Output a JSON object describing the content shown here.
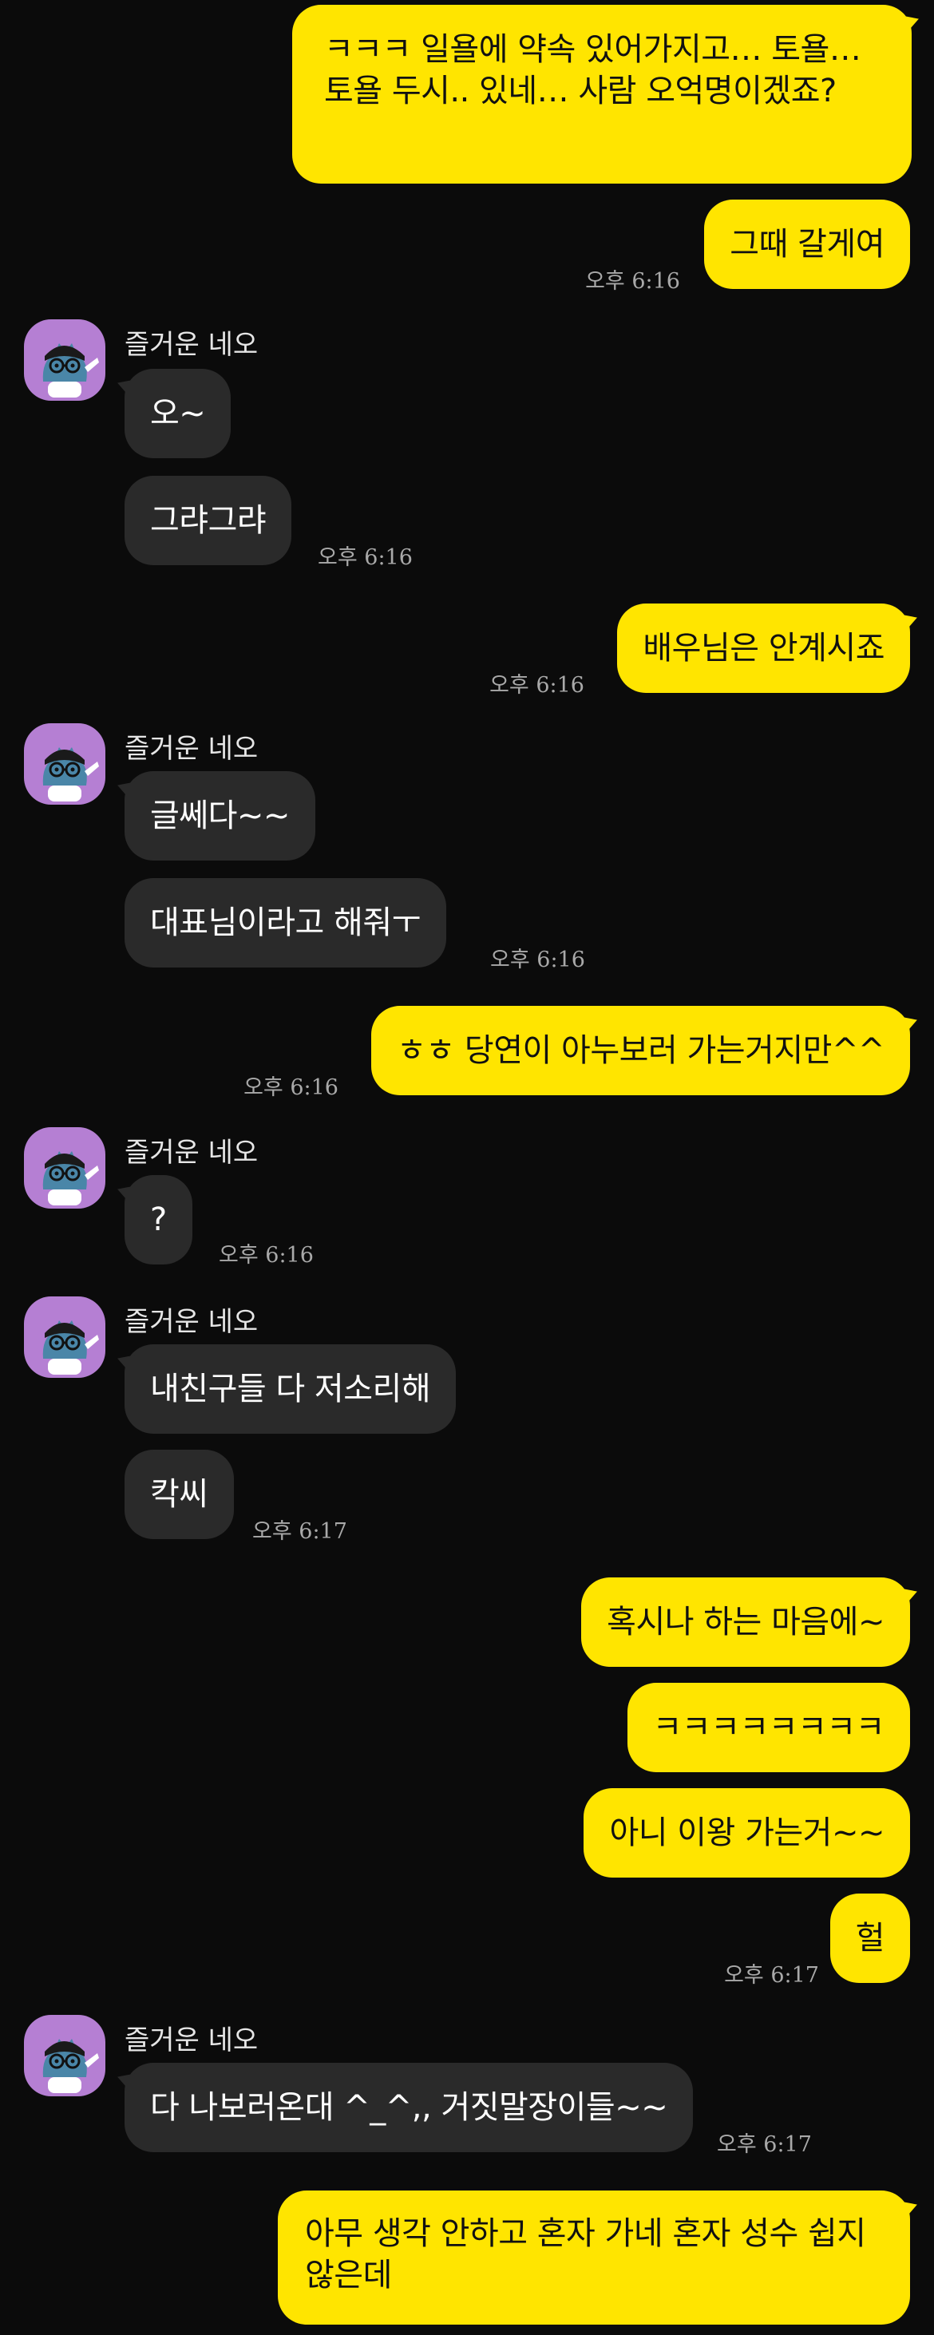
{
  "chat": {
    "partner_name": "즐거운 네오",
    "colors": {
      "background": "#0b0b0b",
      "my_bubble": "#ffe500",
      "their_bubble": "#2a2a2a",
      "timestamp": "#a9a9a9"
    },
    "messages": [
      {
        "from": "me",
        "text": "ㅋㅋㅋ 일욜에 약속 있어가지고… 토욜…  토욜 두시.. 있네… 사람 오억명이겠죠?"
      },
      {
        "from": "me",
        "text": "그때 갈게여",
        "time": "오후 6:16"
      },
      {
        "from": "them",
        "text": "오~"
      },
      {
        "from": "them",
        "text": "그랴그랴",
        "time": "오후 6:16"
      },
      {
        "from": "me",
        "text": "배우님은 안계시죠",
        "time": "오후 6:16"
      },
      {
        "from": "them",
        "text": "글쎄다~~"
      },
      {
        "from": "them",
        "text": "대표님이라고 해줘ㅜ",
        "time": "오후 6:16"
      },
      {
        "from": "me",
        "text": "ㅎㅎ 당연이 아누보러 가는거지만^^",
        "time": "오후 6:16"
      },
      {
        "from": "them",
        "text": "?",
        "time": "오후 6:16"
      },
      {
        "from": "them",
        "text": "내친구들 다 저소리해"
      },
      {
        "from": "them",
        "text": "칵씨",
        "time": "오후 6:17"
      },
      {
        "from": "me",
        "text": "혹시나 하는 마음에~"
      },
      {
        "from": "me",
        "text": "ㅋㅋㅋㅋㅋㅋㅋㅋ"
      },
      {
        "from": "me",
        "text": "아니 이왕 가는거~~"
      },
      {
        "from": "me",
        "text": "헐",
        "time": "오후 6:17"
      },
      {
        "from": "them",
        "text": "다 나보러온대 ^_^,, 거짓말장이들~~",
        "time": "오후 6:17"
      },
      {
        "from": "me",
        "text": "아무 생각 안하고 혼자 가네 혼자 성수 쉽지 않은데"
      }
    ],
    "avatar_icon": "neo-cat-avatar-icon"
  }
}
